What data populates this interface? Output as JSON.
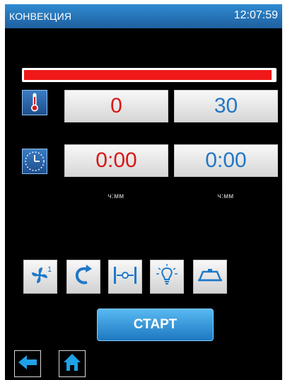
{
  "header": {
    "title": "КОНВЕКЦИЯ",
    "clock": "12:07:59"
  },
  "progress": {
    "fraction": 0.99,
    "color": "#f01818"
  },
  "temperature": {
    "current": "0",
    "target": "30"
  },
  "time": {
    "elapsed": "0:00",
    "remaining": "0:00",
    "unit_left": "ч:мм",
    "unit_right": "ч:мм"
  },
  "tools": [
    {
      "icon": "fan-speed-1-icon",
      "badge": "1"
    },
    {
      "icon": "rotate-arrow-icon"
    },
    {
      "icon": "damper-icon"
    },
    {
      "icon": "lamp-icon"
    },
    {
      "icon": "tray-icon"
    }
  ],
  "actions": {
    "start_label": "СТАРТ"
  },
  "colors": {
    "accent": "#2376c6",
    "current_value": "#d91717",
    "target_value": "#2376c6"
  }
}
